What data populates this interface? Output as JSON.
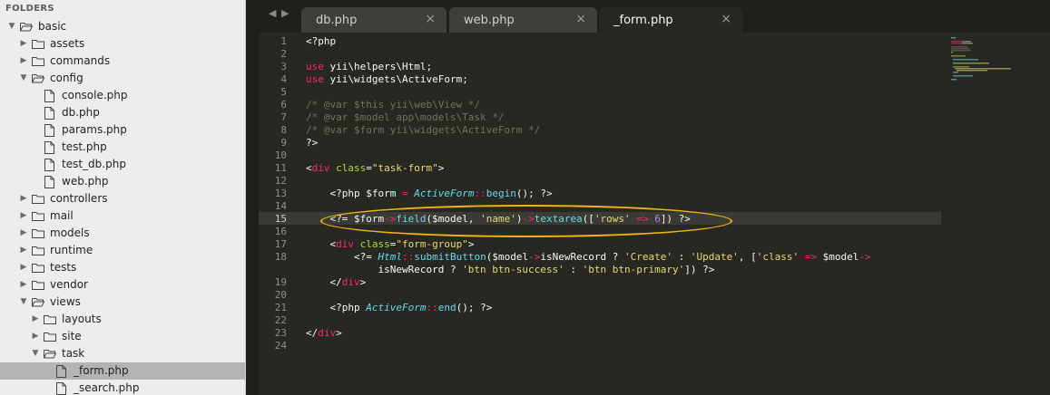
{
  "sidebar": {
    "header": "FOLDERS",
    "items": [
      {
        "label": "basic",
        "type": "folder",
        "depth": 0,
        "expanded": true
      },
      {
        "label": "assets",
        "type": "folder",
        "depth": 1,
        "expanded": false
      },
      {
        "label": "commands",
        "type": "folder",
        "depth": 1,
        "expanded": false
      },
      {
        "label": "config",
        "type": "folder",
        "depth": 1,
        "expanded": true
      },
      {
        "label": "console.php",
        "type": "file",
        "depth": 2
      },
      {
        "label": "db.php",
        "type": "file",
        "depth": 2
      },
      {
        "label": "params.php",
        "type": "file",
        "depth": 2
      },
      {
        "label": "test.php",
        "type": "file",
        "depth": 2
      },
      {
        "label": "test_db.php",
        "type": "file",
        "depth": 2
      },
      {
        "label": "web.php",
        "type": "file",
        "depth": 2
      },
      {
        "label": "controllers",
        "type": "folder",
        "depth": 1,
        "expanded": false
      },
      {
        "label": "mail",
        "type": "folder",
        "depth": 1,
        "expanded": false
      },
      {
        "label": "models",
        "type": "folder",
        "depth": 1,
        "expanded": false
      },
      {
        "label": "runtime",
        "type": "folder",
        "depth": 1,
        "expanded": false
      },
      {
        "label": "tests",
        "type": "folder",
        "depth": 1,
        "expanded": false
      },
      {
        "label": "vendor",
        "type": "folder",
        "depth": 1,
        "expanded": false
      },
      {
        "label": "views",
        "type": "folder",
        "depth": 1,
        "expanded": true
      },
      {
        "label": "layouts",
        "type": "folder",
        "depth": 2,
        "expanded": false
      },
      {
        "label": "site",
        "type": "folder",
        "depth": 2,
        "expanded": false
      },
      {
        "label": "task",
        "type": "folder",
        "depth": 2,
        "expanded": true
      },
      {
        "label": "_form.php",
        "type": "file",
        "depth": 3,
        "selected": true
      },
      {
        "label": "_search.php",
        "type": "file",
        "depth": 3
      }
    ]
  },
  "tabs": [
    {
      "label": "db.php",
      "active": false
    },
    {
      "label": "web.php",
      "active": false
    },
    {
      "label": "_form.php",
      "active": true
    }
  ],
  "icons": {
    "tab_close": "close-icon",
    "nav_back": "arrow-left-icon",
    "nav_forward": "arrow-right-icon",
    "expand": "triangle-right-icon",
    "collapse": "triangle-down-icon"
  },
  "colors": {
    "editor_bg": "#272822",
    "sidebar_bg": "#ededed",
    "highlight_ring": "#f3b313",
    "keyword": "#f92672",
    "function": "#66d9ef",
    "string": "#e6db74",
    "number": "#ae81ff",
    "attribute": "#a6e22e",
    "comment": "#75715e"
  },
  "editor": {
    "current_line": 15,
    "line_numbers": [
      "1",
      "2",
      "3",
      "4",
      "5",
      "6",
      "7",
      "8",
      "9",
      "10",
      "11",
      "12",
      "13",
      "14",
      "15",
      "16",
      "17",
      "18",
      "",
      "19",
      "20",
      "21",
      "22",
      "23",
      "24"
    ],
    "lines": [
      [
        {
          "t": "<?php",
          "c": "p"
        }
      ],
      [],
      [
        {
          "t": "use",
          "c": "k"
        },
        {
          "t": " yii\\helpers\\Html;",
          "c": "p"
        }
      ],
      [
        {
          "t": "use",
          "c": "k"
        },
        {
          "t": " yii\\widgets\\ActiveForm;",
          "c": "p"
        }
      ],
      [],
      [
        {
          "t": "/* @var $this yii\\web\\View */",
          "c": "cm"
        }
      ],
      [
        {
          "t": "/* @var $model app\\models\\Task */",
          "c": "cm"
        }
      ],
      [
        {
          "t": "/* @var $form yii\\widgets\\ActiveForm */",
          "c": "cm"
        }
      ],
      [
        {
          "t": "?>",
          "c": "p"
        }
      ],
      [],
      [
        {
          "t": "<",
          "c": "p"
        },
        {
          "t": "div",
          "c": "k"
        },
        {
          "t": " ",
          "c": "p"
        },
        {
          "t": "class",
          "c": "a"
        },
        {
          "t": "=",
          "c": "p"
        },
        {
          "t": "\"task-form\"",
          "c": "s"
        },
        {
          "t": ">",
          "c": "p"
        }
      ],
      [],
      [
        {
          "t": "    <?php $form ",
          "c": "p"
        },
        {
          "t": "=",
          "c": "k"
        },
        {
          "t": " ",
          "c": "p"
        },
        {
          "t": "ActiveForm",
          "c": "fi"
        },
        {
          "t": "::",
          "c": "k"
        },
        {
          "t": "begin",
          "c": "f"
        },
        {
          "t": "(); ?>",
          "c": "p"
        }
      ],
      [],
      [
        {
          "t": "    <?= $form",
          "c": "p"
        },
        {
          "t": "->",
          "c": "k"
        },
        {
          "t": "field",
          "c": "f"
        },
        {
          "t": "($model, ",
          "c": "p"
        },
        {
          "t": "'name'",
          "c": "s"
        },
        {
          "t": ")",
          "c": "p"
        },
        {
          "t": "->",
          "c": "k"
        },
        {
          "t": "textarea",
          "c": "f"
        },
        {
          "t": "([",
          "c": "p"
        },
        {
          "t": "'rows'",
          "c": "s"
        },
        {
          "t": " ",
          "c": "p"
        },
        {
          "t": "=>",
          "c": "k"
        },
        {
          "t": " ",
          "c": "p"
        },
        {
          "t": "6",
          "c": "n"
        },
        {
          "t": "]) ?>",
          "c": "p"
        }
      ],
      [],
      [
        {
          "t": "    <",
          "c": "p"
        },
        {
          "t": "div",
          "c": "k"
        },
        {
          "t": " ",
          "c": "p"
        },
        {
          "t": "class",
          "c": "a"
        },
        {
          "t": "=",
          "c": "p"
        },
        {
          "t": "\"form-group\"",
          "c": "s"
        },
        {
          "t": ">",
          "c": "p"
        }
      ],
      [
        {
          "t": "        <?= ",
          "c": "p"
        },
        {
          "t": "Html",
          "c": "fi"
        },
        {
          "t": "::",
          "c": "k"
        },
        {
          "t": "submitButton",
          "c": "f"
        },
        {
          "t": "($model",
          "c": "p"
        },
        {
          "t": "->",
          "c": "k"
        },
        {
          "t": "isNewRecord ? ",
          "c": "p"
        },
        {
          "t": "'Create'",
          "c": "s"
        },
        {
          "t": " : ",
          "c": "p"
        },
        {
          "t": "'Update'",
          "c": "s"
        },
        {
          "t": ", [",
          "c": "p"
        },
        {
          "t": "'class'",
          "c": "s"
        },
        {
          "t": " ",
          "c": "p"
        },
        {
          "t": "=>",
          "c": "k"
        },
        {
          "t": " $model",
          "c": "p"
        },
        {
          "t": "->",
          "c": "k"
        }
      ],
      [
        {
          "t": "            isNewRecord ? ",
          "c": "p"
        },
        {
          "t": "'btn btn-success'",
          "c": "s"
        },
        {
          "t": " : ",
          "c": "p"
        },
        {
          "t": "'btn btn-primary'",
          "c": "s"
        },
        {
          "t": "]) ?>",
          "c": "p"
        }
      ],
      [
        {
          "t": "    </",
          "c": "p"
        },
        {
          "t": "div",
          "c": "k"
        },
        {
          "t": ">",
          "c": "p"
        }
      ],
      [],
      [
        {
          "t": "    <?php ",
          "c": "p"
        },
        {
          "t": "ActiveForm",
          "c": "fi"
        },
        {
          "t": "::",
          "c": "k"
        },
        {
          "t": "end",
          "c": "f"
        },
        {
          "t": "(); ?>",
          "c": "p"
        }
      ],
      [],
      [
        {
          "t": "</",
          "c": "p"
        },
        {
          "t": "div",
          "c": "k"
        },
        {
          "t": ">",
          "c": "p"
        }
      ],
      []
    ]
  }
}
